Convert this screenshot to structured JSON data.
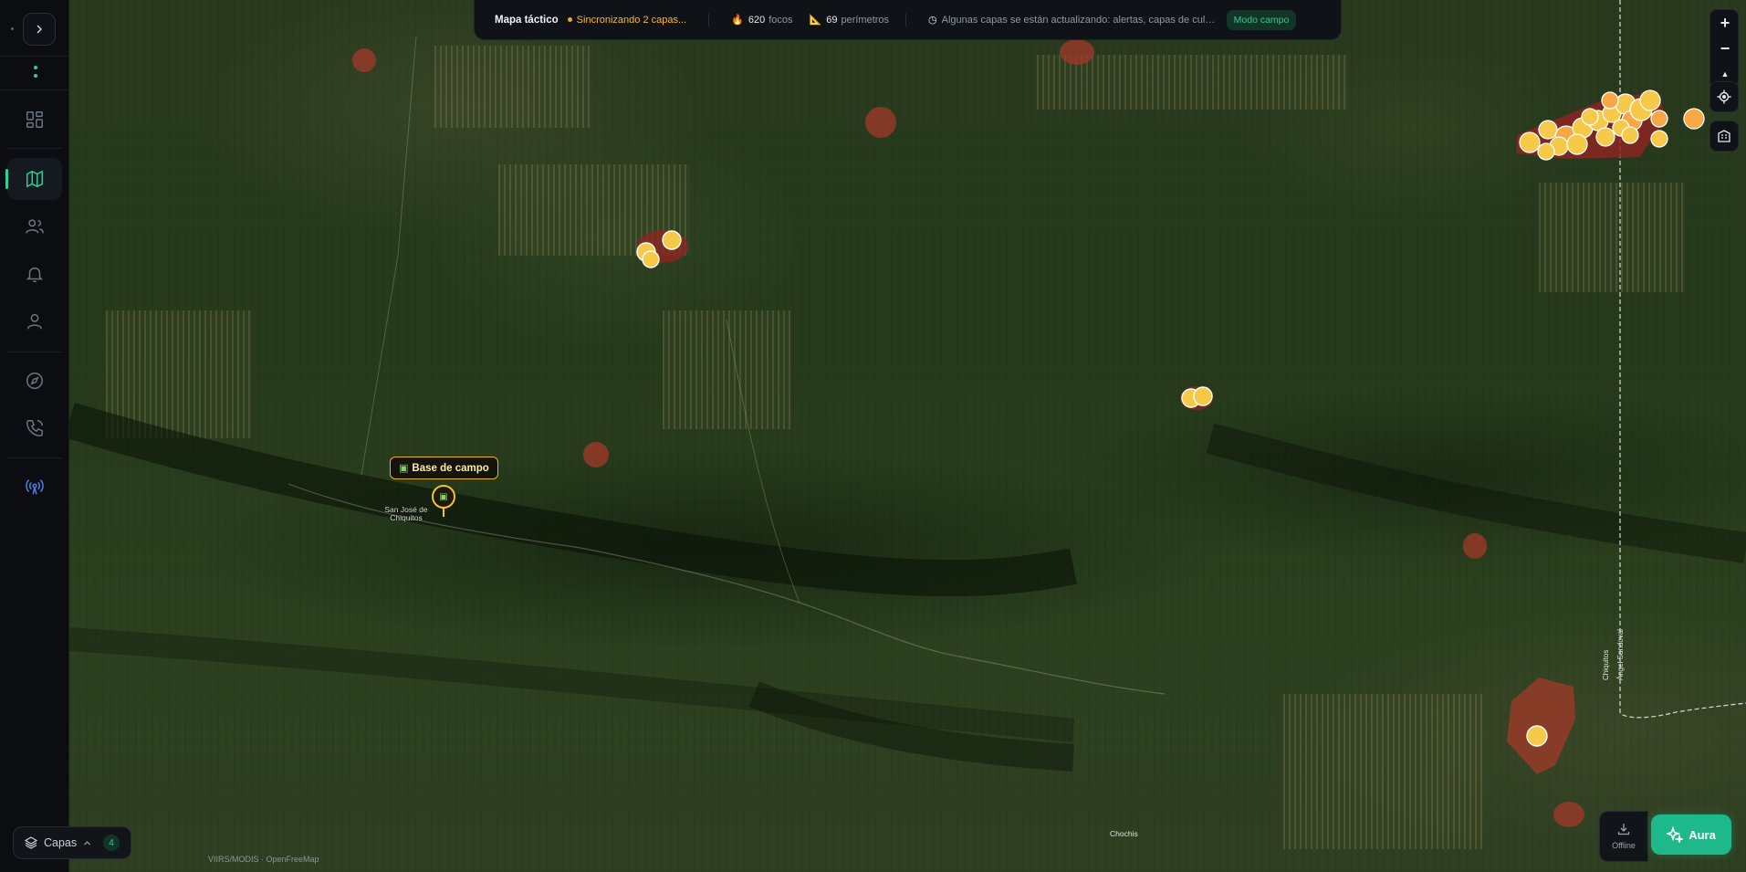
{
  "sidebar": {
    "expand_icon": "chevron-right-icon",
    "items": [
      {
        "name": "dashboard",
        "icon": "grid-icon",
        "active": false
      },
      {
        "name": "map",
        "icon": "map-icon",
        "active": true
      },
      {
        "name": "team",
        "icon": "users-icon",
        "active": false
      },
      {
        "name": "alerts",
        "icon": "bell-icon",
        "active": false
      },
      {
        "name": "profile",
        "icon": "user-icon",
        "active": false
      },
      {
        "name": "explore",
        "icon": "compass-icon",
        "active": false
      },
      {
        "name": "calls",
        "icon": "phone-icon",
        "active": false
      },
      {
        "name": "radio",
        "icon": "broadcast-icon",
        "active": false
      }
    ]
  },
  "topbar": {
    "title": "Mapa táctico",
    "sync_status": "Sincronizando 2 capas...",
    "fires_count": "620",
    "fires_label": "focos",
    "perimeters_count": "69",
    "perimeters_label": "perímetros",
    "message": "Algunas capas se están actualizando: alertas, capas de cultivo",
    "mode": "Modo campo"
  },
  "map": {
    "base_label": "Base de campo",
    "town_name": "San José de Chiquitos",
    "town_chochis": "Chochis",
    "road_label_1": "Chiquitos",
    "road_label_2": "Ángel Sandoval",
    "attribution": "VIIRS/MODIS · OpenFreeMap"
  },
  "controls": {
    "zoom_in": "+",
    "zoom_out": "−",
    "north": "▲"
  },
  "layers": {
    "label": "Capas",
    "count": "4"
  },
  "offline": {
    "label": "Offline"
  },
  "aura": {
    "label": "Aura"
  },
  "colors": {
    "accent": "#1db98a",
    "fire": "#f7c948",
    "perimeter": "#9a2b23",
    "warning": "#f4a62a"
  }
}
